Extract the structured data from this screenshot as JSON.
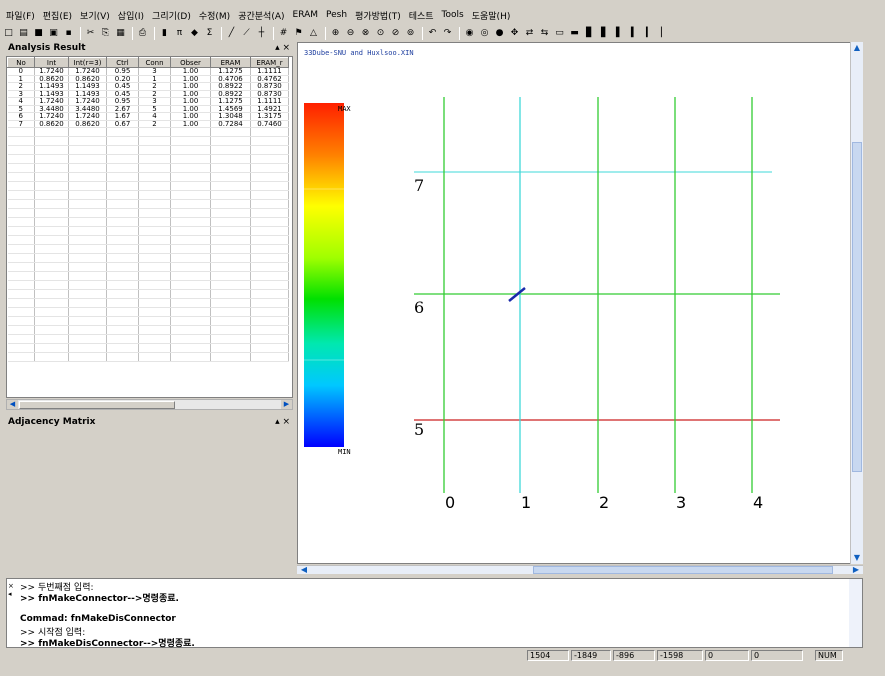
{
  "menu": [
    "파일(F)",
    "편집(E)",
    "보기(V)",
    "삽입(I)",
    "그리기(D)",
    "수정(M)",
    "공간분석(A)",
    "ERAM",
    "Pesh",
    "평가방법(T)",
    "테스트",
    "Tools",
    "도움말(H)"
  ],
  "toolbar_icons": [
    "new-icon",
    "open-icon",
    "save-icon",
    "image-icon",
    "export-icon",
    "cut-icon",
    "copy-icon",
    "paste-icon",
    "print-icon",
    "layer-icon",
    "pi-icon",
    "eye-icon",
    "sigma-icon",
    "line-icon",
    "polyline-icon",
    "cross-icon",
    "grid-icon",
    "edit-icon",
    "shape-icon",
    "zoom-in-icon",
    "zoom-out-icon",
    "zoom-window-icon",
    "zoom-all-icon",
    "zoom-prev-icon",
    "zoom-extent-icon",
    "undo-icon",
    "redo-icon",
    "eye-icon",
    "target-icon",
    "node-icon",
    "move-icon",
    "connect-icon",
    "disconnect-icon",
    "region-icon",
    "chart-icon",
    "bar-chart-icon",
    "bar-chart2-icon",
    "bar-chart3-icon",
    "bar-chart4-icon",
    "bar-chart5-icon",
    "bar-chart6-icon"
  ],
  "toolbar_glyphs": [
    "□",
    "▤",
    "■",
    "▣",
    "▪",
    "✂",
    "⎘",
    "▦",
    "⎙",
    "▮",
    "π",
    "◆",
    "Σ",
    "╱",
    "⟋",
    "┼",
    "#",
    "⚑",
    "△",
    "⊕",
    "⊖",
    "⊗",
    "⊙",
    "⊘",
    "⊚",
    "↶",
    "↷",
    "◉",
    "◎",
    "●",
    "✥",
    "⇄",
    "⇆",
    "▭",
    "▬",
    "▊",
    "▋",
    "▌",
    "▍",
    "▎",
    "▏"
  ],
  "analysis": {
    "title": "Analysis Result",
    "controls": "▴ ×",
    "columns": [
      "No",
      "Int",
      "Int(r=3)",
      "Ctrl",
      "Conn",
      "Obser",
      "ERAM",
      "ERAM_r"
    ],
    "rows": [
      [
        "0",
        "1.7240",
        "1.7240",
        "0.95",
        "3",
        "1.00",
        "1.1275",
        "1.1111"
      ],
      [
        "1",
        "0.8620",
        "0.8620",
        "0.20",
        "1",
        "1.00",
        "0.4706",
        "0.4762"
      ],
      [
        "2",
        "1.1493",
        "1.1493",
        "0.45",
        "2",
        "1.00",
        "0.8922",
        "0.8730"
      ],
      [
        "3",
        "1.1493",
        "1.1493",
        "0.45",
        "2",
        "1.00",
        "0.8922",
        "0.8730"
      ],
      [
        "4",
        "1.7240",
        "1.7240",
        "0.95",
        "3",
        "1.00",
        "1.1275",
        "1.1111"
      ],
      [
        "5",
        "3.4480",
        "3.4480",
        "2.67",
        "5",
        "1.00",
        "1.4569",
        "1.4921"
      ],
      [
        "6",
        "1.7240",
        "1.7240",
        "1.67",
        "4",
        "1.00",
        "1.3048",
        "1.3175"
      ],
      [
        "7",
        "0.8620",
        "0.8620",
        "0.67",
        "2",
        "1.00",
        "0.7284",
        "0.7460"
      ]
    ]
  },
  "adjacency": {
    "title": "Adjacency Matrix",
    "controls": "▴ ×"
  },
  "viewport": {
    "doc_title": "33Dube-SNU and Huxlsoo.XIN",
    "legend_max": "MAX",
    "legend_min": "MIN",
    "vertical_lines": [
      {
        "label": "0",
        "color": "#33cc33"
      },
      {
        "label": "1",
        "color": "#40d8d8"
      },
      {
        "label": "2",
        "color": "#33cc33"
      },
      {
        "label": "3",
        "color": "#33cc33"
      },
      {
        "label": "4",
        "color": "#33cc33"
      }
    ],
    "horizontal_lines": [
      {
        "label": "7",
        "color": "#66e0e0"
      },
      {
        "label": "6",
        "color": "#33cc33"
      },
      {
        "label": "5",
        "color": "#cc2222"
      }
    ]
  },
  "console": {
    "lines": [
      {
        "text": ">> 두번째점 입력:",
        "bold": false
      },
      {
        "text": ">> fnMakeConnector-->명령종료.",
        "bold": true
      },
      {
        "text": "",
        "bold": false
      },
      {
        "text": "Commad: fnMakeDisConnector",
        "bold": true
      },
      {
        "text": ">> 시작점 입력:",
        "bold": false
      },
      {
        "text": ">> fnMakeDisConnector-->명령종료.",
        "bold": true
      }
    ],
    "side_controls": "×\n◂"
  },
  "status": [
    "1504",
    "-1849",
    "-896",
    "-1598",
    "0",
    "0",
    "NUM"
  ]
}
